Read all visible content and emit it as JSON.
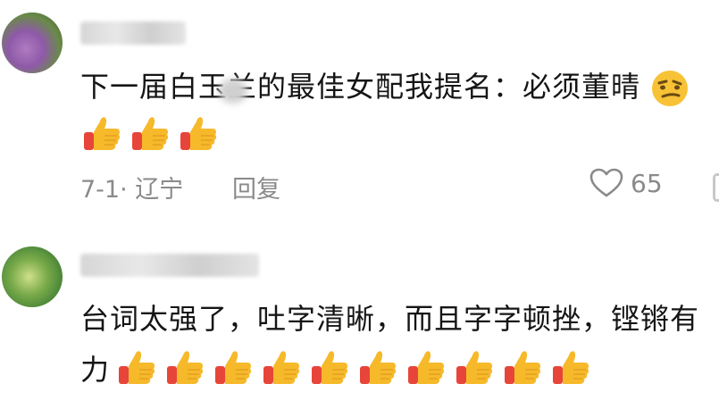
{
  "comments": [
    {
      "avatar": "avatar-photo",
      "username": "",
      "text": "下一届白玉兰的最佳女配我提名：必须董晴",
      "trailing_emoji": "smirk-face",
      "thumbs_count": 3,
      "date_location": "7-1· 辽宁",
      "reply_label": "回复",
      "like_count": "65"
    },
    {
      "avatar": "avatar-photo",
      "username": "",
      "text": "台词太强了，吐字清晰，而且字字顿挫，铿锵有",
      "text_line2": "力",
      "thumbs_count": 10
    }
  ],
  "icons": {
    "heart": "heart-outline-icon",
    "thumb": "thumbs-up-emoji",
    "face": "smirk-face-emoji"
  },
  "colors": {
    "text": "#151515",
    "meta": "#8a8a8a",
    "thumb": "#f5b92a",
    "cuff": "#e8453a"
  }
}
